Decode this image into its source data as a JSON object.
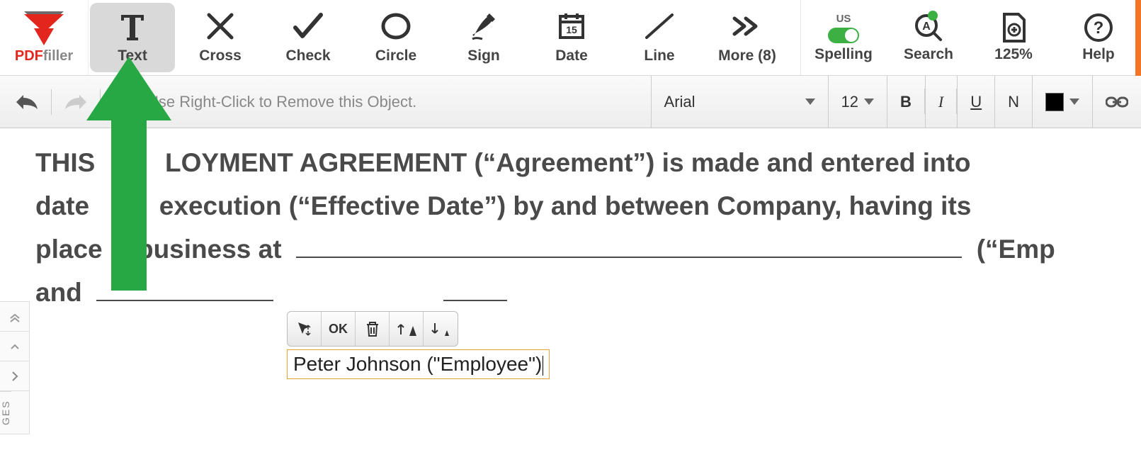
{
  "logo": {
    "brand_a": "PDF",
    "brand_b": "filler"
  },
  "toolbar": {
    "text": "Text",
    "cross": "Cross",
    "check": "Check",
    "circle": "Circle",
    "sign": "Sign",
    "date": "Date",
    "line": "Line",
    "more": "More (8)"
  },
  "right_toolbar": {
    "spelling_lang": "US",
    "spelling": "Spelling",
    "search": "Search",
    "zoom": "125%",
    "help": "Help"
  },
  "subbar": {
    "hint": "Use Right-Click to Remove this Object.",
    "font": "Arial",
    "size": "12",
    "bold": "B",
    "italic": "I",
    "underline": "U",
    "normal": "N"
  },
  "document": {
    "line1a": "THIS",
    "line1b": "LOYMENT AGREEMENT (“Agreement”) is made and entered into",
    "line2a": "date",
    "line2b": "execution (“Effective Date”) by and between Company, having its",
    "line3a": "place",
    "line3b": "business at",
    "line3c": "(“Emp",
    "line4": "and"
  },
  "pagenav": {
    "label": "GES"
  },
  "mini": {
    "ok": "OK"
  },
  "entry": {
    "text": "Peter Johnson (\"Employee\")"
  },
  "colors": {
    "accent_green": "#3cb043",
    "brand_red": "#e2261e",
    "arrow_green": "#28a745"
  }
}
